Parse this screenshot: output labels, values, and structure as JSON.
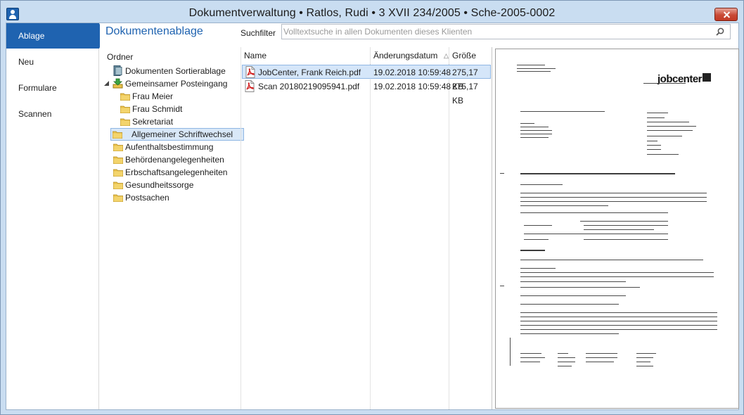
{
  "window": {
    "title": "Dokumentverwaltung  •  Ratlos, Rudi  •  3 XVII 234/2005  •  Sche-2005-0002"
  },
  "nav": {
    "items": [
      {
        "label": "Ablage",
        "active": true
      },
      {
        "label": "Neu",
        "active": false
      },
      {
        "label": "Formulare",
        "active": false
      },
      {
        "label": "Scannen",
        "active": false
      }
    ]
  },
  "panel": {
    "title": "Dokumentenablage"
  },
  "search": {
    "label": "Suchfilter",
    "placeholder": "Volltextsuche in allen Dokumenten dieses Klienten",
    "value": ""
  },
  "tree": {
    "header": "Ordner",
    "items": [
      {
        "label": "Dokumenten Sortierablage",
        "icon": "sorting-tray-icon"
      },
      {
        "label": "Gemeinsamer Posteingang",
        "icon": "inbox-download-icon",
        "expanded": true
      },
      {
        "label": "Frau Meier",
        "icon": "folder-icon"
      },
      {
        "label": "Frau Schmidt",
        "icon": "folder-icon"
      },
      {
        "label": "Sekretariat",
        "icon": "folder-icon"
      },
      {
        "label": "Allgemeiner Schriftwechsel",
        "icon": "folder-icon",
        "selected": true
      },
      {
        "label": "Aufenthaltsbestimmung",
        "icon": "folder-icon"
      },
      {
        "label": "Behördenangelegenheiten",
        "icon": "folder-icon"
      },
      {
        "label": "Erbschaftsangelegenheiten",
        "icon": "folder-icon"
      },
      {
        "label": "Gesundheitssorge",
        "icon": "folder-icon"
      },
      {
        "label": "Postsachen",
        "icon": "folder-icon"
      }
    ]
  },
  "files": {
    "columns": [
      "Name",
      "Änderungsdatum",
      "Größe"
    ],
    "sort_indicator": "△",
    "rows": [
      {
        "name": "JobCenter, Frank Reich.pdf",
        "date": "19.02.2018 10:59:48",
        "size": "275,17 KB",
        "selected": true
      },
      {
        "name": "Scan 20180219095941.pdf",
        "date": "19.02.2018 10:59:48",
        "size": "275,17 KB",
        "selected": false
      }
    ]
  },
  "preview": {
    "logo_text": "jobcenter"
  },
  "colors": {
    "accent": "#1f63b0",
    "selection": "#d5e6f9",
    "close": "#c94a36",
    "titlebar": "#c9ddf1"
  }
}
